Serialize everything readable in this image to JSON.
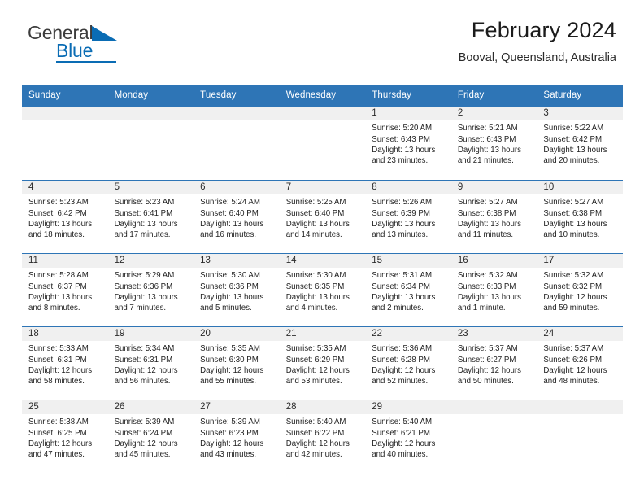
{
  "brand": {
    "name_part1": "General",
    "name_part2": "Blue",
    "flag_icon": "flag-triangle-icon",
    "accent_color": "#0a6cb4"
  },
  "header": {
    "title": "February 2024",
    "subtitle": "Booval, Queensland, Australia"
  },
  "theme": {
    "header_blue": "#2e75b6",
    "daynum_band": "#f0f0f0",
    "text": "#1f1f1f"
  },
  "weekdays": [
    "Sunday",
    "Monday",
    "Tuesday",
    "Wednesday",
    "Thursday",
    "Friday",
    "Saturday"
  ],
  "weeks": [
    [
      {
        "day": ""
      },
      {
        "day": ""
      },
      {
        "day": ""
      },
      {
        "day": ""
      },
      {
        "day": "1",
        "sunrise": "Sunrise: 5:20 AM",
        "sunset": "Sunset: 6:43 PM",
        "daylight_line1": "Daylight: 13 hours",
        "daylight_line2": "and 23 minutes."
      },
      {
        "day": "2",
        "sunrise": "Sunrise: 5:21 AM",
        "sunset": "Sunset: 6:43 PM",
        "daylight_line1": "Daylight: 13 hours",
        "daylight_line2": "and 21 minutes."
      },
      {
        "day": "3",
        "sunrise": "Sunrise: 5:22 AM",
        "sunset": "Sunset: 6:42 PM",
        "daylight_line1": "Daylight: 13 hours",
        "daylight_line2": "and 20 minutes."
      }
    ],
    [
      {
        "day": "4",
        "sunrise": "Sunrise: 5:23 AM",
        "sunset": "Sunset: 6:42 PM",
        "daylight_line1": "Daylight: 13 hours",
        "daylight_line2": "and 18 minutes."
      },
      {
        "day": "5",
        "sunrise": "Sunrise: 5:23 AM",
        "sunset": "Sunset: 6:41 PM",
        "daylight_line1": "Daylight: 13 hours",
        "daylight_line2": "and 17 minutes."
      },
      {
        "day": "6",
        "sunrise": "Sunrise: 5:24 AM",
        "sunset": "Sunset: 6:40 PM",
        "daylight_line1": "Daylight: 13 hours",
        "daylight_line2": "and 16 minutes."
      },
      {
        "day": "7",
        "sunrise": "Sunrise: 5:25 AM",
        "sunset": "Sunset: 6:40 PM",
        "daylight_line1": "Daylight: 13 hours",
        "daylight_line2": "and 14 minutes."
      },
      {
        "day": "8",
        "sunrise": "Sunrise: 5:26 AM",
        "sunset": "Sunset: 6:39 PM",
        "daylight_line1": "Daylight: 13 hours",
        "daylight_line2": "and 13 minutes."
      },
      {
        "day": "9",
        "sunrise": "Sunrise: 5:27 AM",
        "sunset": "Sunset: 6:38 PM",
        "daylight_line1": "Daylight: 13 hours",
        "daylight_line2": "and 11 minutes."
      },
      {
        "day": "10",
        "sunrise": "Sunrise: 5:27 AM",
        "sunset": "Sunset: 6:38 PM",
        "daylight_line1": "Daylight: 13 hours",
        "daylight_line2": "and 10 minutes."
      }
    ],
    [
      {
        "day": "11",
        "sunrise": "Sunrise: 5:28 AM",
        "sunset": "Sunset: 6:37 PM",
        "daylight_line1": "Daylight: 13 hours",
        "daylight_line2": "and 8 minutes."
      },
      {
        "day": "12",
        "sunrise": "Sunrise: 5:29 AM",
        "sunset": "Sunset: 6:36 PM",
        "daylight_line1": "Daylight: 13 hours",
        "daylight_line2": "and 7 minutes."
      },
      {
        "day": "13",
        "sunrise": "Sunrise: 5:30 AM",
        "sunset": "Sunset: 6:36 PM",
        "daylight_line1": "Daylight: 13 hours",
        "daylight_line2": "and 5 minutes."
      },
      {
        "day": "14",
        "sunrise": "Sunrise: 5:30 AM",
        "sunset": "Sunset: 6:35 PM",
        "daylight_line1": "Daylight: 13 hours",
        "daylight_line2": "and 4 minutes."
      },
      {
        "day": "15",
        "sunrise": "Sunrise: 5:31 AM",
        "sunset": "Sunset: 6:34 PM",
        "daylight_line1": "Daylight: 13 hours",
        "daylight_line2": "and 2 minutes."
      },
      {
        "day": "16",
        "sunrise": "Sunrise: 5:32 AM",
        "sunset": "Sunset: 6:33 PM",
        "daylight_line1": "Daylight: 13 hours",
        "daylight_line2": "and 1 minute."
      },
      {
        "day": "17",
        "sunrise": "Sunrise: 5:32 AM",
        "sunset": "Sunset: 6:32 PM",
        "daylight_line1": "Daylight: 12 hours",
        "daylight_line2": "and 59 minutes."
      }
    ],
    [
      {
        "day": "18",
        "sunrise": "Sunrise: 5:33 AM",
        "sunset": "Sunset: 6:31 PM",
        "daylight_line1": "Daylight: 12 hours",
        "daylight_line2": "and 58 minutes."
      },
      {
        "day": "19",
        "sunrise": "Sunrise: 5:34 AM",
        "sunset": "Sunset: 6:31 PM",
        "daylight_line1": "Daylight: 12 hours",
        "daylight_line2": "and 56 minutes."
      },
      {
        "day": "20",
        "sunrise": "Sunrise: 5:35 AM",
        "sunset": "Sunset: 6:30 PM",
        "daylight_line1": "Daylight: 12 hours",
        "daylight_line2": "and 55 minutes."
      },
      {
        "day": "21",
        "sunrise": "Sunrise: 5:35 AM",
        "sunset": "Sunset: 6:29 PM",
        "daylight_line1": "Daylight: 12 hours",
        "daylight_line2": "and 53 minutes."
      },
      {
        "day": "22",
        "sunrise": "Sunrise: 5:36 AM",
        "sunset": "Sunset: 6:28 PM",
        "daylight_line1": "Daylight: 12 hours",
        "daylight_line2": "and 52 minutes."
      },
      {
        "day": "23",
        "sunrise": "Sunrise: 5:37 AM",
        "sunset": "Sunset: 6:27 PM",
        "daylight_line1": "Daylight: 12 hours",
        "daylight_line2": "and 50 minutes."
      },
      {
        "day": "24",
        "sunrise": "Sunrise: 5:37 AM",
        "sunset": "Sunset: 6:26 PM",
        "daylight_line1": "Daylight: 12 hours",
        "daylight_line2": "and 48 minutes."
      }
    ],
    [
      {
        "day": "25",
        "sunrise": "Sunrise: 5:38 AM",
        "sunset": "Sunset: 6:25 PM",
        "daylight_line1": "Daylight: 12 hours",
        "daylight_line2": "and 47 minutes."
      },
      {
        "day": "26",
        "sunrise": "Sunrise: 5:39 AM",
        "sunset": "Sunset: 6:24 PM",
        "daylight_line1": "Daylight: 12 hours",
        "daylight_line2": "and 45 minutes."
      },
      {
        "day": "27",
        "sunrise": "Sunrise: 5:39 AM",
        "sunset": "Sunset: 6:23 PM",
        "daylight_line1": "Daylight: 12 hours",
        "daylight_line2": "and 43 minutes."
      },
      {
        "day": "28",
        "sunrise": "Sunrise: 5:40 AM",
        "sunset": "Sunset: 6:22 PM",
        "daylight_line1": "Daylight: 12 hours",
        "daylight_line2": "and 42 minutes."
      },
      {
        "day": "29",
        "sunrise": "Sunrise: 5:40 AM",
        "sunset": "Sunset: 6:21 PM",
        "daylight_line1": "Daylight: 12 hours",
        "daylight_line2": "and 40 minutes."
      },
      {
        "day": ""
      },
      {
        "day": ""
      }
    ]
  ]
}
